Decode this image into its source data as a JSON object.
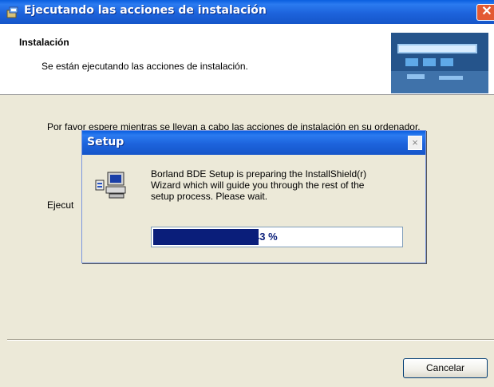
{
  "window": {
    "title": "Ejecutando las acciones de instalación",
    "close_glyph": "✕"
  },
  "header": {
    "title": "Instalación",
    "subtitle": "Se están ejecutando las acciones de instalación."
  },
  "body": {
    "line1": "Por favor espere mientras se llevan a cabo las acciones de instalación en su ordenador.",
    "line2_prefix": "Ejecut"
  },
  "setup_dialog": {
    "title": "Setup",
    "close_glyph": "×",
    "message": "Borland BDE Setup is preparing the InstallShield(r)\nWizard which will guide you through the rest of the\nsetup process.  Please wait.",
    "progress_fraction": 0.43,
    "progress_label": "43 %"
  },
  "footer": {
    "cancel_label": "Cancelar"
  },
  "colors": {
    "titlebar": "#1d63dc",
    "close_red": "#e35a33",
    "progress_fill": "#0a1e7a"
  }
}
